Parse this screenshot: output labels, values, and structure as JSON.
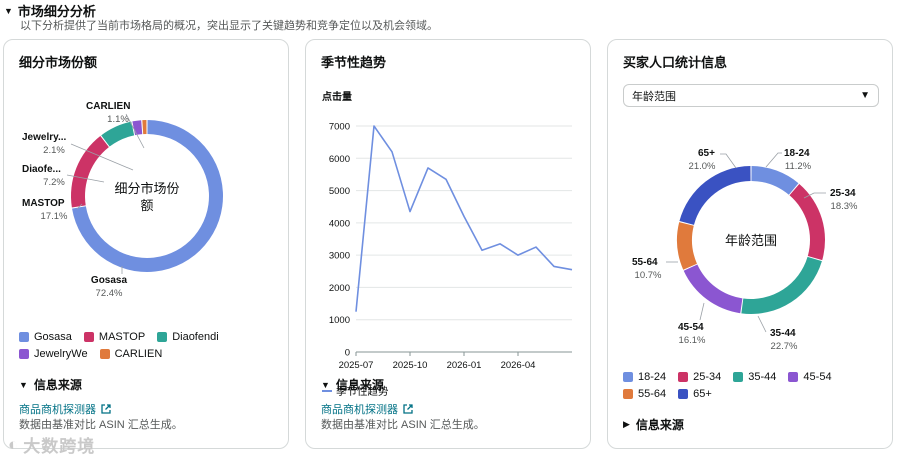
{
  "header": {
    "title": "市场细分分析",
    "description": "以下分析提供了当前市场格局的概况，突出显示了关键趋势和竞争定位以及机会领域。"
  },
  "share_card": {
    "title": "细分市场份额",
    "center_label_line1": "细分市场份",
    "center_label_line2": "额",
    "segments": [
      {
        "name": "Gosasa",
        "label": "Gosasa",
        "percent": 72.4,
        "pct_text": "72.4%",
        "color": "#6f8fe0"
      },
      {
        "name": "MASTOP",
        "label": "MASTOP",
        "percent": 17.1,
        "pct_text": "17.1%",
        "color": "#cc3366"
      },
      {
        "name": "Diaofendi",
        "label": "Diaofe...",
        "percent": 7.2,
        "pct_text": "7.2%",
        "color": "#2ea597"
      },
      {
        "name": "JewelryWe",
        "label": "Jewelry...",
        "percent": 2.1,
        "pct_text": "2.1%",
        "color": "#8b56d1"
      },
      {
        "name": "CARLIEN",
        "label": "CARLIEN",
        "percent": 1.1,
        "pct_text": "1.1%",
        "color": "#e07a3c"
      }
    ],
    "legend": [
      "Gosasa",
      "MASTOP",
      "Diaofendi",
      "JewelryWe",
      "CARLIEN"
    ],
    "source_title": "信息来源",
    "source_link": "商品商机探测器",
    "source_note": "数据由基准对比 ASIN 汇总生成。"
  },
  "trend_card": {
    "title": "季节性趋势",
    "legend_label": "季节性趋势",
    "source_title": "信息来源",
    "source_link": "商品商机探测器",
    "source_note": "数据由基准对比 ASIN 汇总生成。"
  },
  "demo_card": {
    "title": "买家人口统计信息",
    "dropdown_value": "年龄范围",
    "center_label": "年龄范围",
    "segments": [
      {
        "name": "18-24",
        "percent": 11.2,
        "pct_text": "11.2%",
        "color": "#6f8fe0"
      },
      {
        "name": "25-34",
        "percent": 18.3,
        "pct_text": "18.3%",
        "color": "#cc3366"
      },
      {
        "name": "35-44",
        "percent": 22.7,
        "pct_text": "22.7%",
        "color": "#2ea597"
      },
      {
        "name": "45-54",
        "percent": 16.1,
        "pct_text": "16.1%",
        "color": "#8b56d1"
      },
      {
        "name": "55-64",
        "percent": 10.7,
        "pct_text": "10.7%",
        "color": "#e07a3c"
      },
      {
        "name": "65+",
        "percent": 21.0,
        "pct_text": "21.0%",
        "color": "#3a52c2"
      }
    ],
    "legend": [
      "18-24",
      "25-34",
      "35-44",
      "45-54",
      "55-64",
      "65+"
    ],
    "source_title": "信息来源"
  },
  "chart_data": [
    {
      "type": "pie",
      "title": "细分市场份额",
      "categories": [
        "Gosasa",
        "MASTOP",
        "Diaofendi",
        "JewelryWe",
        "CARLIEN"
      ],
      "values": [
        72.4,
        17.1,
        7.2,
        2.1,
        1.1
      ]
    },
    {
      "type": "line",
      "title": "季节性趋势",
      "ylabel": "点击量",
      "xlabel": "",
      "ylim": [
        0,
        7000
      ],
      "yticks": [
        0,
        1000,
        2000,
        3000,
        4000,
        5000,
        6000,
        7000
      ],
      "xticks": [
        "2025-07",
        "2025-10",
        "2026-01",
        "2026-04"
      ],
      "series": [
        {
          "name": "季节性趋势",
          "color": "#6f8fe0",
          "x": [
            "2025-07",
            "2025-08",
            "2025-09",
            "2025-10",
            "2025-11",
            "2025-12",
            "2026-01",
            "2026-02",
            "2026-03",
            "2026-04",
            "2026-05",
            "2026-06",
            "2026-07"
          ],
          "values": [
            1250,
            7000,
            6200,
            4350,
            5700,
            5350,
            4200,
            3150,
            3350,
            3000,
            3250,
            2650,
            2550
          ]
        }
      ]
    },
    {
      "type": "pie",
      "title": "年龄范围",
      "categories": [
        "18-24",
        "25-34",
        "35-44",
        "45-54",
        "55-64",
        "65+"
      ],
      "values": [
        11.2,
        18.3,
        22.7,
        16.1,
        10.7,
        21.0
      ]
    }
  ],
  "watermark": "大数跨境"
}
